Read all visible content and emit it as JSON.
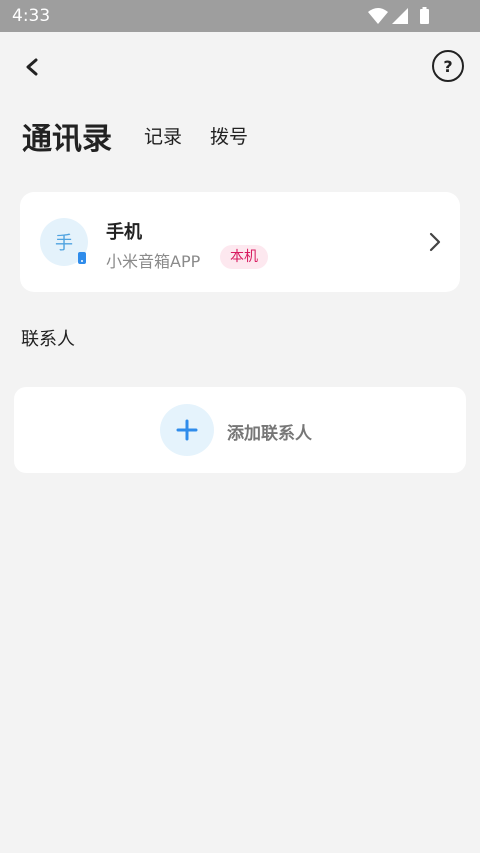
{
  "status_bar": {
    "time": "4:33"
  },
  "header": {
    "help_glyph": "?"
  },
  "tabs": [
    {
      "label": "通讯录",
      "active": true
    },
    {
      "label": "记录",
      "active": false
    },
    {
      "label": "拨号",
      "active": false
    }
  ],
  "device": {
    "avatar_char": "手",
    "name": "手机",
    "subtitle": "小米音箱APP",
    "tag": "本机"
  },
  "section_title": "联系人",
  "add_contact": {
    "label": "添加联系人"
  },
  "colors": {
    "accent_blue": "#2f8ceb",
    "tag_pink": "#d81b60",
    "tag_bg": "#fde8ef",
    "avatar_bg": "#e4f2fb"
  },
  "icons": [
    "back-arrow-icon",
    "help-icon",
    "chevron-right-icon",
    "plus-icon",
    "phone-badge-icon",
    "wifi-icon",
    "signal-icon",
    "battery-icon"
  ]
}
